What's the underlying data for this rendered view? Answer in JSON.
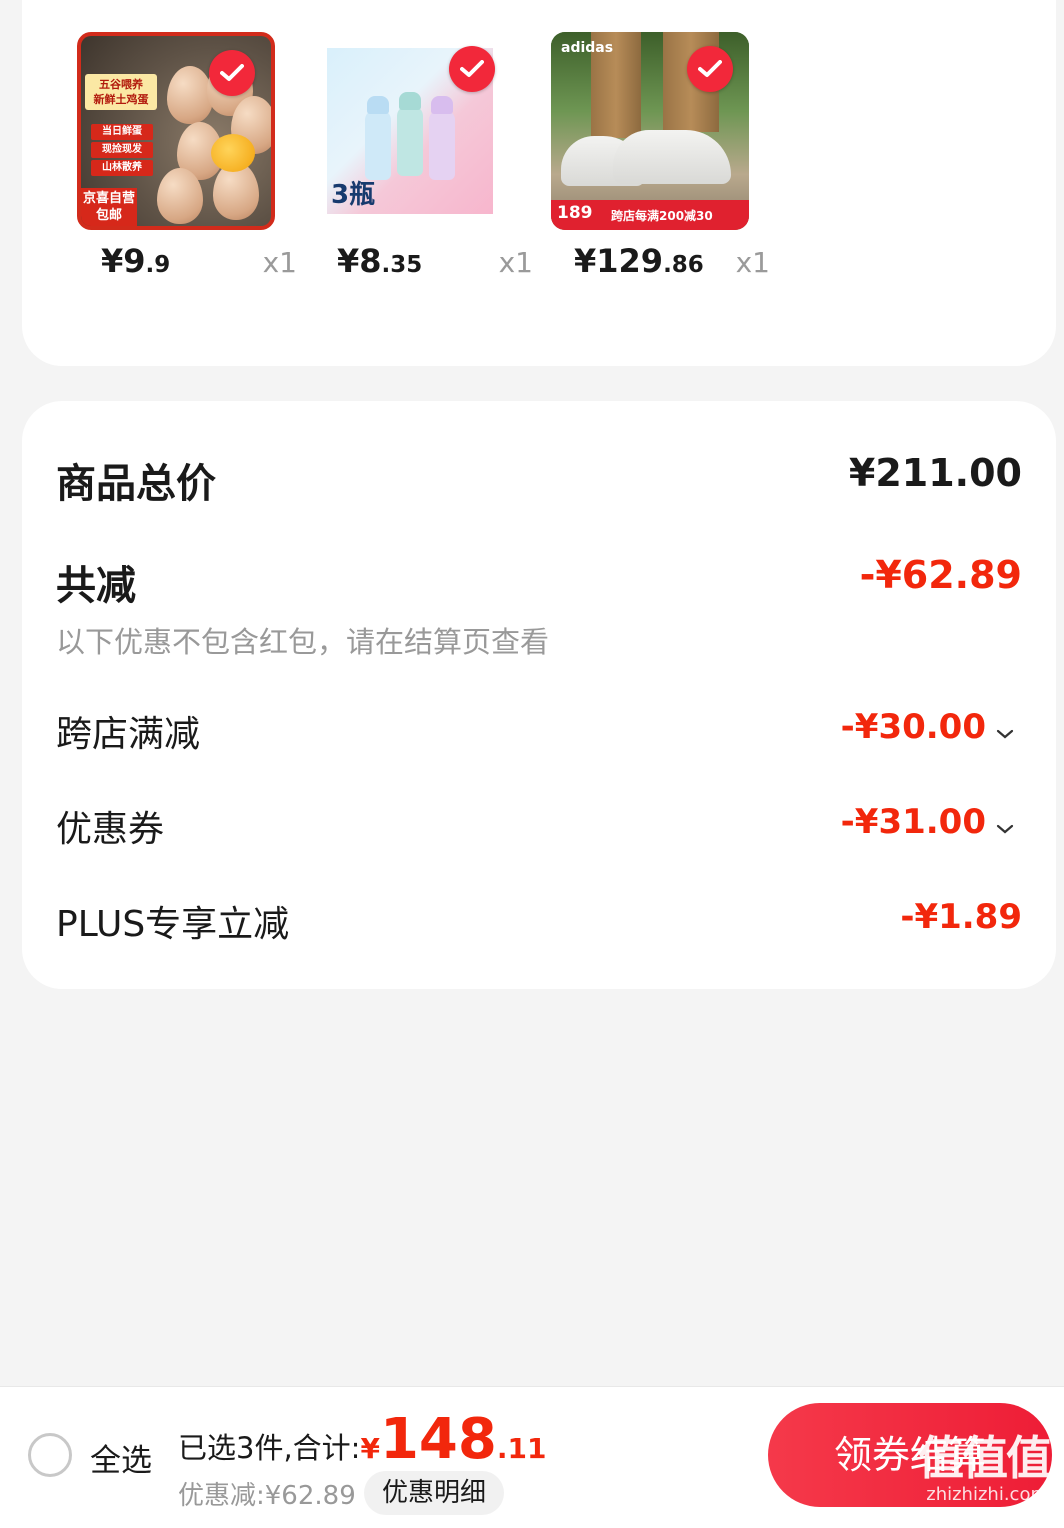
{
  "products": [
    {
      "name": "eggs",
      "price_main": "¥9",
      "price_cents": ".9",
      "qty": "x1",
      "thumb_tag": "五谷喂养\n新鲜土鸡蛋",
      "thumb_lines": [
        "当日鲜蛋",
        "现捡现发",
        "山林散养"
      ],
      "thumb_bottom": "京喜自营\n包邮",
      "checked": true
    },
    {
      "name": "bottles",
      "price_main": "¥8",
      "price_cents": ".35",
      "qty": "x1",
      "thumb_label": "3瓶",
      "checked": true
    },
    {
      "name": "shoes",
      "price_main": "¥129",
      "price_cents": ".86",
      "qty": "x1",
      "thumb_brand": "adidas",
      "thumb_price": "189",
      "thumb_promo": "跨店每满200减30",
      "checked": true
    }
  ],
  "summary": {
    "total_label": "商品总价",
    "total_value": "¥211.00",
    "reduce_label": "共减",
    "reduce_value": "-¥62.89",
    "note": "以下优惠不包含红包，请在结算页查看",
    "items": [
      {
        "label": "跨店满减",
        "value": "-¥30.00",
        "expandable": true
      },
      {
        "label": "优惠券",
        "value": "-¥31.00",
        "expandable": true
      },
      {
        "label": "PLUS专享立减",
        "value": "-¥1.89",
        "expandable": false
      }
    ]
  },
  "bottom_bar": {
    "select_all": "全选",
    "selected_text": "已选3件,合计:",
    "currency": "¥",
    "total_int": "148",
    "total_dec": ".11",
    "discount_text": "优惠减:¥62.89",
    "detail_button": "优惠明细",
    "checkout_button": "领券结算"
  },
  "watermark": {
    "main": "值值值",
    "sub": "zhizhizhi.com"
  },
  "colors": {
    "accent": "#f2270c",
    "button": "#ee1d36",
    "check": "#f2283a"
  }
}
